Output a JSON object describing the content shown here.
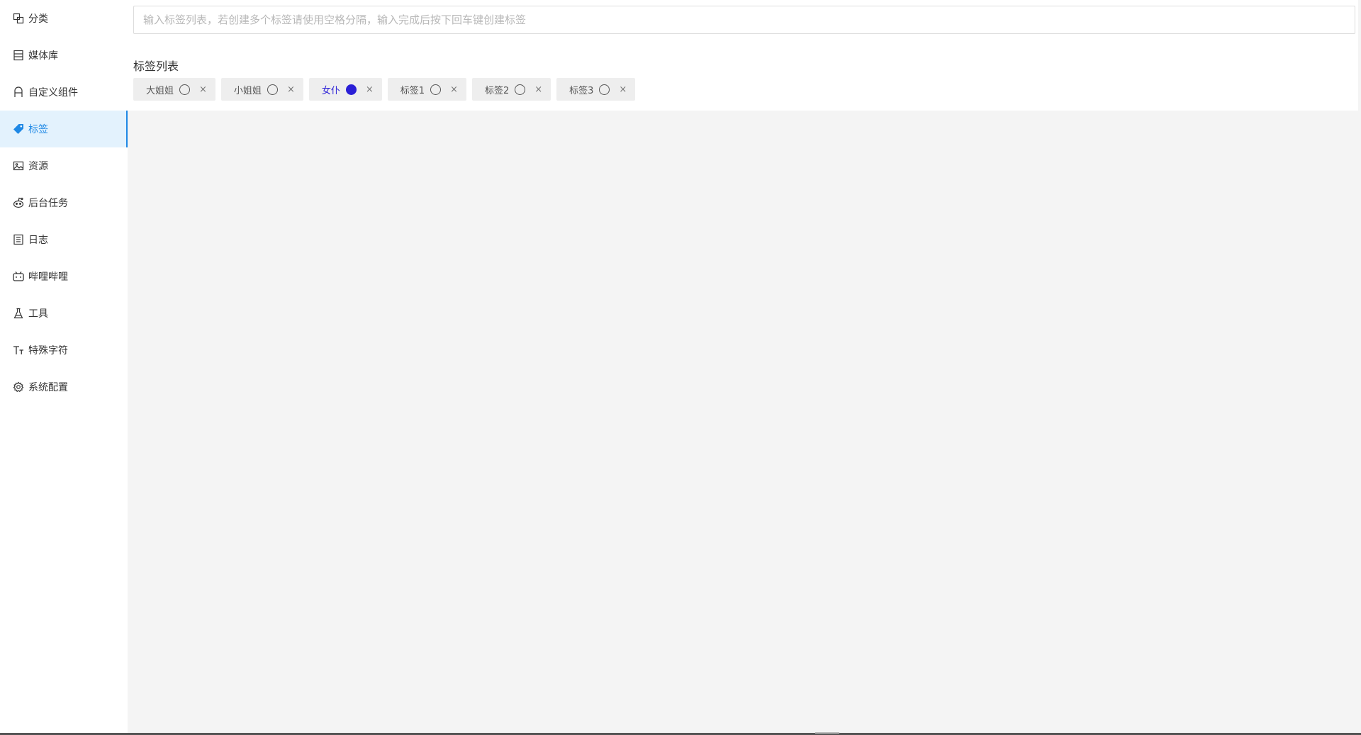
{
  "sidebar": {
    "items": [
      {
        "label": "分类",
        "icon": "category-icon"
      },
      {
        "label": "媒体库",
        "icon": "media-library-icon"
      },
      {
        "label": "自定义组件",
        "icon": "custom-component-icon"
      },
      {
        "label": "标签",
        "icon": "tag-icon",
        "active": true
      },
      {
        "label": "资源",
        "icon": "image-icon"
      },
      {
        "label": "后台任务",
        "icon": "robot-icon"
      },
      {
        "label": "日志",
        "icon": "log-icon"
      },
      {
        "label": "哔哩哔哩",
        "icon": "bilibili-icon"
      },
      {
        "label": "工具",
        "icon": "flask-icon"
      },
      {
        "label": "特殊字符",
        "icon": "text-size-icon"
      },
      {
        "label": "系统配置",
        "icon": "gear-icon"
      }
    ]
  },
  "search": {
    "placeholder": "输入标签列表，若创建多个标签请使用空格分隔，输入完成后按下回车键创建标签",
    "value": ""
  },
  "tags": {
    "title": "标签列表",
    "items": [
      {
        "label": "大姐姐",
        "selected": false
      },
      {
        "label": "小姐姐",
        "selected": false
      },
      {
        "label": "女仆",
        "selected": true
      },
      {
        "label": "标签1",
        "selected": false
      },
      {
        "label": "标签2",
        "selected": false
      },
      {
        "label": "标签3",
        "selected": false
      }
    ],
    "close_glyph": "×"
  },
  "colors": {
    "accent": "#1e88e5",
    "active_bg": "#e3f2fd",
    "selected_tag": "#2a1fd6"
  }
}
